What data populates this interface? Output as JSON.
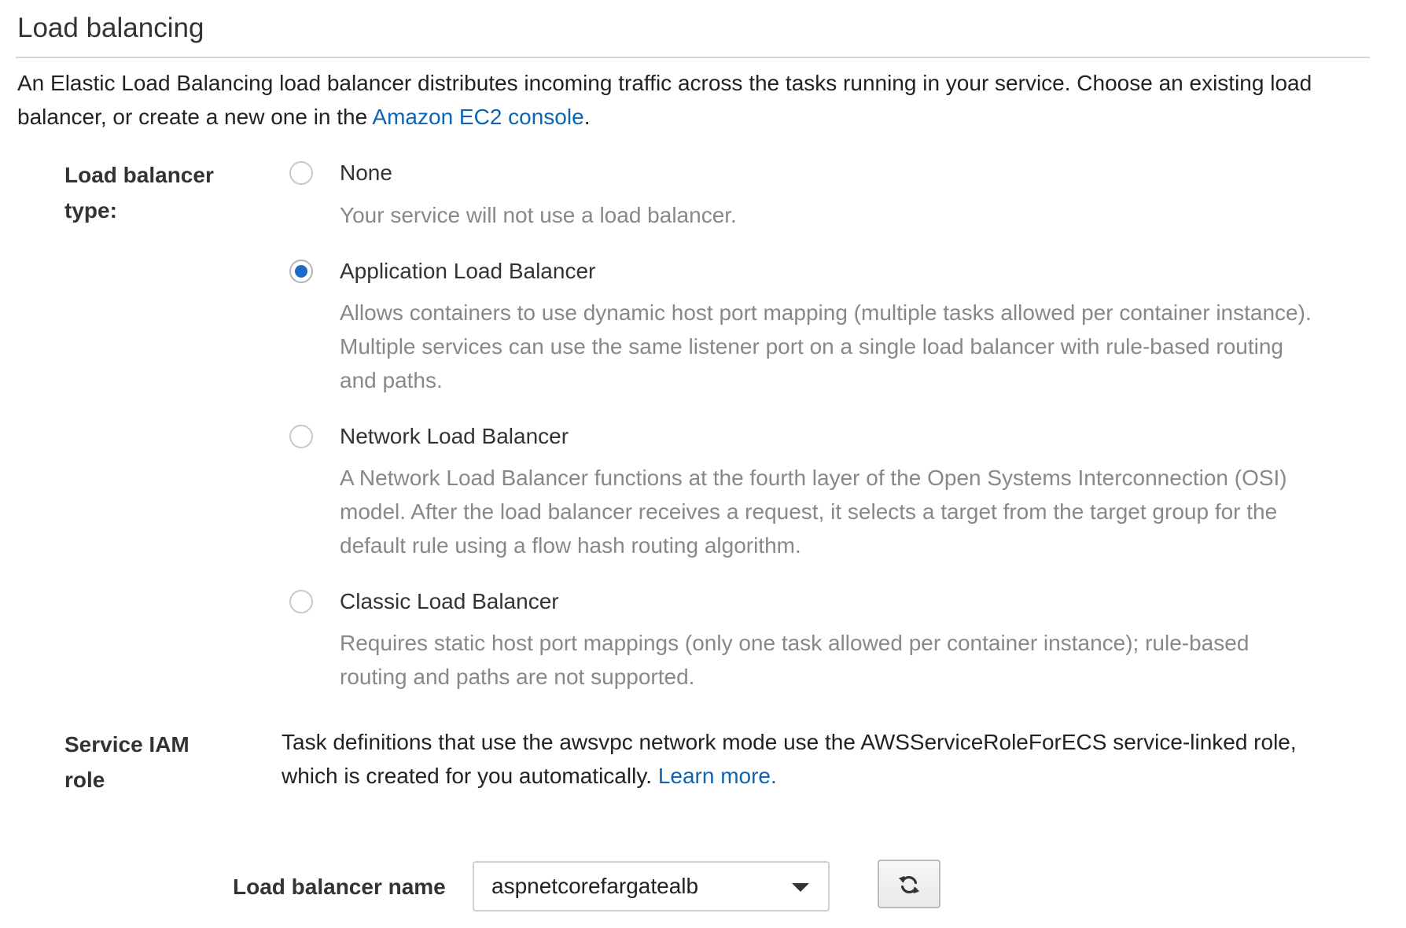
{
  "section": {
    "title": "Load balancing"
  },
  "intro": {
    "text": "An Elastic Load Balancing load balancer distributes incoming traffic across the tasks running in your service. Choose an existing load balancer, or create a new one in the ",
    "link": "Amazon EC2 console",
    "suffix": "."
  },
  "load_balancer_type": {
    "label_line1": "Load balancer",
    "label_line2": "type:",
    "selected": "application",
    "options": [
      {
        "key": "none",
        "title": "None",
        "description": "Your service will not use a load balancer."
      },
      {
        "key": "application",
        "title": "Application Load Balancer",
        "description": "Allows containers to use dynamic host port mapping (multiple tasks allowed per container instance). Multiple services can use the same listener port on a single load balancer with rule-based routing and paths."
      },
      {
        "key": "network",
        "title": "Network Load Balancer",
        "description": "A Network Load Balancer functions at the fourth layer of the Open Systems Interconnection (OSI) model. After the load balancer receives a request, it selects a target from the target group for the default rule using a flow hash routing algorithm."
      },
      {
        "key": "classic",
        "title": "Classic Load Balancer",
        "description": "Requires static host port mappings (only one task allowed per container instance); rule-based routing and paths are not supported."
      }
    ]
  },
  "service_iam_role": {
    "label_line1": "Service IAM",
    "label_line2": "role",
    "text": "Task definitions that use the awsvpc network mode use the AWSServiceRoleForECS service-linked role, which is created for you automatically. ",
    "link": "Learn more."
  },
  "load_balancer_name": {
    "label": "Load balancer name",
    "value": "aspnetcorefargatealb"
  },
  "icons": {
    "dropdown": "chevron-down-icon",
    "refresh": "refresh-icon"
  },
  "colors": {
    "link": "#0d64b5",
    "radio_selected": "#1b6ac4",
    "description_text": "#888888"
  }
}
